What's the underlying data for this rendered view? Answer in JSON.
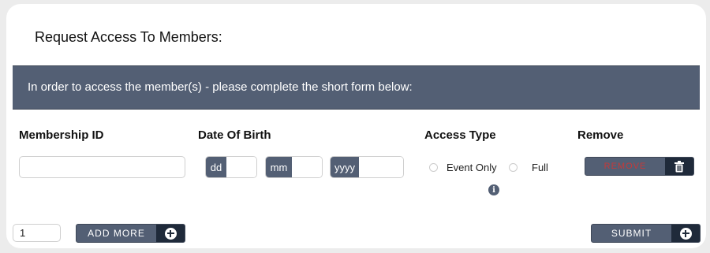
{
  "page": {
    "title": "Request Access To Members:",
    "banner_text": "In order to access the member(s) - please complete the short form below:"
  },
  "columns": {
    "membership_id": "Membership ID",
    "date_of_birth": "Date Of Birth",
    "access_type": "Access Type",
    "remove": "Remove"
  },
  "form_row": {
    "membership_id_value": "",
    "dob": {
      "day_addon": "dd",
      "month_addon": "mm",
      "year_addon": "yyyy",
      "day_value": "",
      "month_value": "",
      "year_value": ""
    },
    "access_options": [
      {
        "label": "Event Only",
        "selected": false
      },
      {
        "label": "Full",
        "selected": false
      }
    ],
    "info_icon": "info-icon",
    "remove_label": "REMOVE",
    "remove_icon": "trash-icon"
  },
  "footer": {
    "count_value": "1",
    "add_more_label": "ADD MORE",
    "add_more_icon": "plus-circle-icon",
    "submit_label": "SUBMIT",
    "submit_icon": "plus-circle-icon"
  },
  "colors": {
    "accent": "#535f74",
    "accent_dark": "#1f2a3a",
    "remove_text": "#c43a3a",
    "background": "#ececec"
  }
}
